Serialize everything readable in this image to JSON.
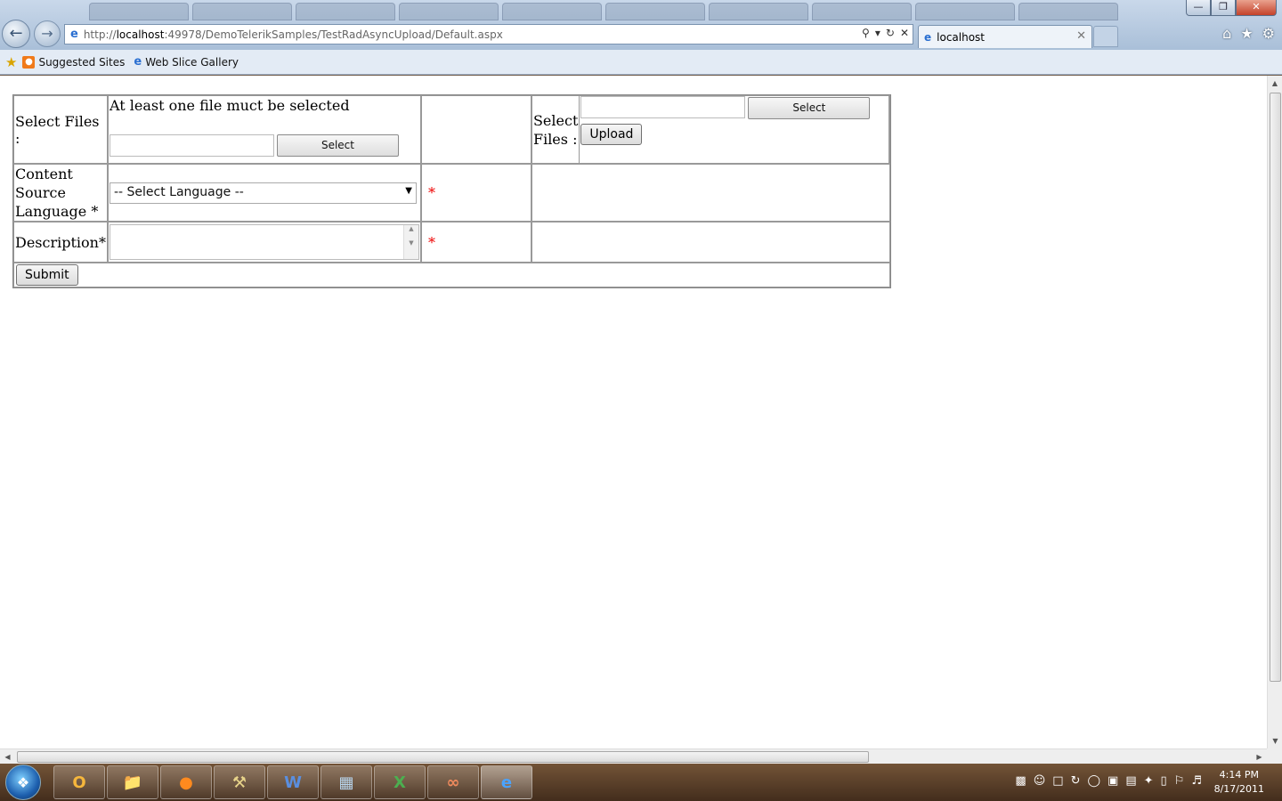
{
  "browser": {
    "address_url_prefix": "http://",
    "address_host": "localhost",
    "address_url_rest": ":49978/DemoTelerikSamples/TestRadAsyncUpload/Default.aspx",
    "active_tab_title": "localhost",
    "favorites": [
      "Suggested Sites",
      "Web Slice Gallery"
    ]
  },
  "form": {
    "select_files_label": "Select Files :",
    "validation_message": "At least one file muct be selected",
    "select_button_label": "Select",
    "right_select_files_label_line1": "Select",
    "right_select_files_label_line2": "Files :",
    "right_select_button_label": "Select",
    "upload_button_label": "Upload",
    "content_source_line1": "Content",
    "content_source_line2": "Source",
    "content_source_line3": "Language *",
    "language_selected": "-- Select Language --",
    "required_marker": "*",
    "description_label": "Description*",
    "submit_label": "Submit"
  },
  "taskbar": {
    "time": "4:14 PM",
    "date": "8/17/2011"
  },
  "colors": {
    "required": "#e00000",
    "page_bg": "#ffffff"
  }
}
